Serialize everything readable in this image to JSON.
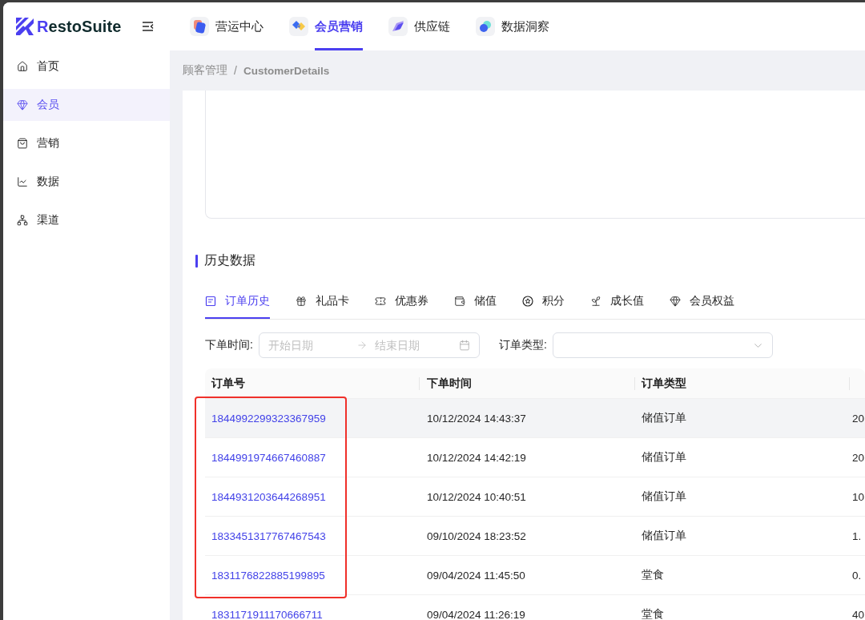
{
  "header": {
    "logo_text": "RestoSuite",
    "nav": [
      {
        "label": "营运中心",
        "selected": false
      },
      {
        "label": "会员营销",
        "selected": true
      },
      {
        "label": "供应链",
        "selected": false
      },
      {
        "label": "数据洞察",
        "selected": false
      }
    ]
  },
  "sidebar": {
    "items": [
      {
        "label": "首页",
        "selected": false
      },
      {
        "label": "会员",
        "selected": true
      },
      {
        "label": "营销",
        "selected": false
      },
      {
        "label": "数据",
        "selected": false
      },
      {
        "label": "渠道",
        "selected": false
      }
    ]
  },
  "breadcrumb": {
    "items": [
      "顾客管理",
      "CustomerDetails"
    ],
    "separator": "/"
  },
  "history": {
    "title": "历史数据",
    "tabs": [
      {
        "label": "订单历史",
        "selected": true
      },
      {
        "label": "礼品卡",
        "selected": false
      },
      {
        "label": "优惠券",
        "selected": false
      },
      {
        "label": "储值",
        "selected": false
      },
      {
        "label": "积分",
        "selected": false
      },
      {
        "label": "成长值",
        "selected": false
      },
      {
        "label": "会员权益",
        "selected": false
      }
    ],
    "filters": {
      "date_label": "下单时间:",
      "start_placeholder": "开始日期",
      "end_placeholder": "结束日期",
      "type_label": "订单类型:"
    },
    "table": {
      "columns": [
        "订单号",
        "下单时间",
        "订单类型"
      ],
      "rows": [
        {
          "order_no": "1844992299323367959",
          "order_time": "10/12/2024 14:43:37",
          "order_type": "储值订单",
          "column_4": "20",
          "hovered": true
        },
        {
          "order_no": "1844991974667460887",
          "order_time": "10/12/2024 14:42:19",
          "order_type": "储值订单",
          "column_4": "20",
          "hovered": false
        },
        {
          "order_no": "1844931203644268951",
          "order_time": "10/12/2024 10:40:51",
          "order_type": "储值订单",
          "column_4": "10",
          "hovered": false
        },
        {
          "order_no": "1833451317767467543",
          "order_time": "09/10/2024 18:23:52",
          "order_type": "储值订单",
          "column_4": "1.",
          "hovered": false
        },
        {
          "order_no": "1831176822885199895",
          "order_time": "09/04/2024 11:45:50",
          "order_type": "堂食",
          "column_4": "0.",
          "hovered": false
        },
        {
          "order_no": "1831171911170666711",
          "order_time": "09/04/2024 11:26:19",
          "order_type": "堂食",
          "column_4": "40",
          "hovered": false
        }
      ]
    }
  }
}
